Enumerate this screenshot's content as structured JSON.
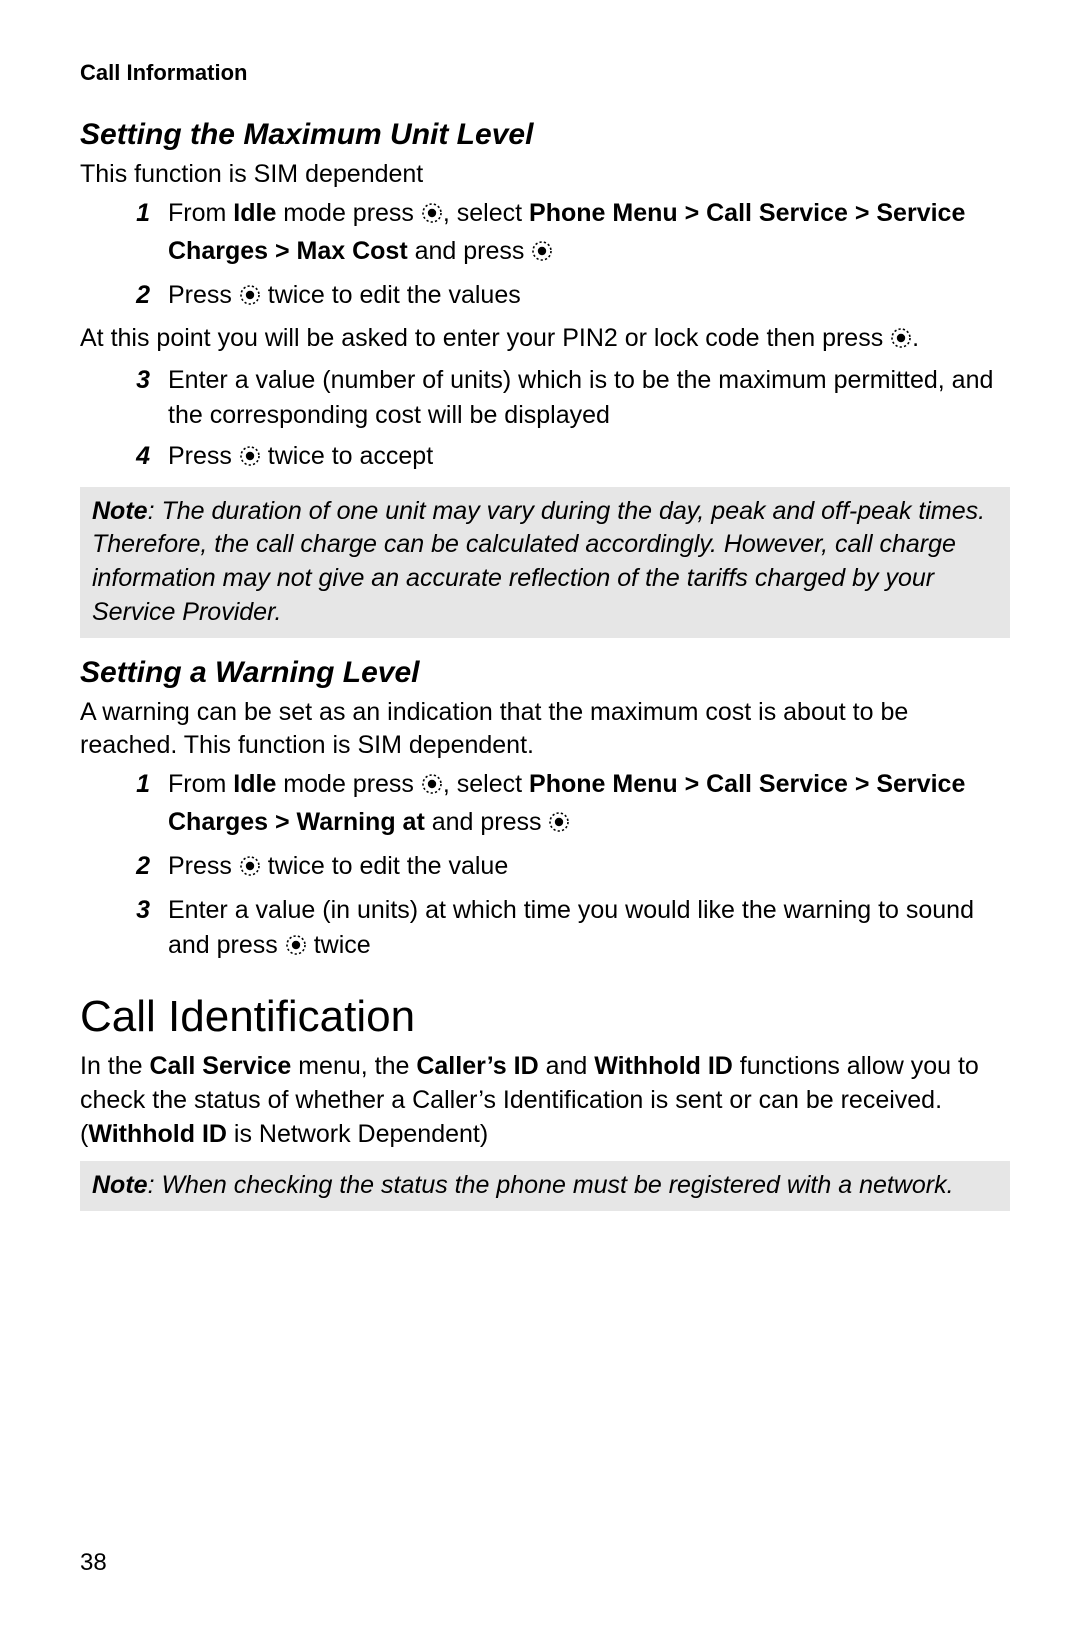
{
  "runningHead": "Call Information",
  "pageNumber": "38",
  "sec1": {
    "heading": "Setting the Maximum Unit Level",
    "intro": "This function is SIM dependent",
    "steps": {
      "s1a": "From ",
      "s1b": "Idle",
      "s1c": " mode press ",
      "s1d": ", select ",
      "s1e": "Phone Menu > Call Service > Service Charges > Max Cost",
      "s1f": " and press ",
      "s2a": "Press ",
      "s2b": " twice to edit the values"
    },
    "mid1": "At this point you will be asked to enter your PIN2 or lock code then press ",
    "mid2": ".",
    "steps2": {
      "s3": "Enter a value (number of units) which is to be the maximum permitted, and the corresponding cost will be displayed",
      "s4a": "Press ",
      "s4b": " twice to accept"
    },
    "noteLabel": "Note",
    "noteText": ": The duration of one unit may vary during the day, peak and off-peak times. Therefore, the call charge can be calculated accordingly. However, call charge information may not give an accurate reflection of the tariffs charged by your Service Provider."
  },
  "sec2": {
    "heading": "Setting a Warning Level",
    "intro": "A warning can be set as an indication that the maximum cost is about to be reached. This function is SIM dependent.",
    "steps": {
      "s1a": "From ",
      "s1b": "Idle",
      "s1c": " mode press ",
      "s1d": ", select ",
      "s1e": "Phone Menu > Call Service > Service Charges > Warning at",
      "s1f": " and press ",
      "s2a": "Press ",
      "s2b": " twice to edit the value",
      "s3a": "Enter a value (in units) at which time you would like the warning to sound and press ",
      "s3b": " twice"
    }
  },
  "sec3": {
    "heading": "Call Identification",
    "p1a": "In the ",
    "p1b": "Call Service",
    "p1c": " menu, the ",
    "p1d": "Caller’s ID",
    "p1e": " and ",
    "p1f": "Withhold ID",
    "p1g": " functions allow you to check the status of whether a Caller’s Identification is sent or can be received. (",
    "p1h": "Withhold ID",
    "p1i": " is Network Dependent)",
    "noteLabel": "Note",
    "noteText": ": When checking the status the phone must be registered with a network."
  }
}
